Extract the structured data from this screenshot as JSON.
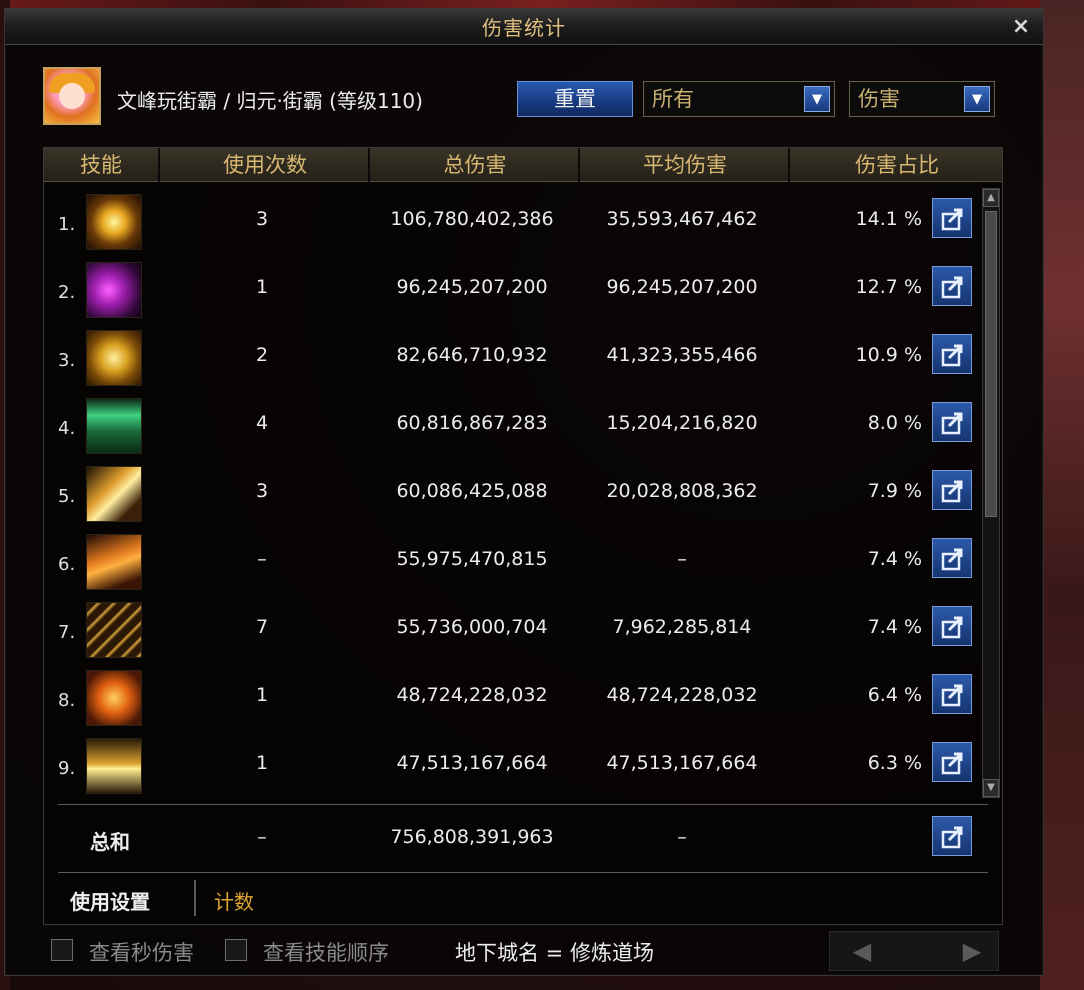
{
  "window": {
    "title": "伤害统计",
    "close_icon": "×"
  },
  "header": {
    "character": "文峰玩街霸 / 归元·街霸 (等级110)",
    "reset_label": "重置",
    "filter_selected": "所有",
    "metric_selected": "伤害",
    "dropdown_arrow": "▼"
  },
  "table": {
    "columns": [
      "技能",
      "使用次数",
      "总伤害",
      "平均伤害",
      "伤害占比"
    ],
    "rows": [
      {
        "num": "1.",
        "uses": "3",
        "total": "106,780,402,386",
        "avg": "35,593,467,462",
        "pct": "14.1 %"
      },
      {
        "num": "2.",
        "uses": "1",
        "total": "96,245,207,200",
        "avg": "96,245,207,200",
        "pct": "12.7 %"
      },
      {
        "num": "3.",
        "uses": "2",
        "total": "82,646,710,932",
        "avg": "41,323,355,466",
        "pct": "10.9 %"
      },
      {
        "num": "4.",
        "uses": "4",
        "total": "60,816,867,283",
        "avg": "15,204,216,820",
        "pct": "8.0 %"
      },
      {
        "num": "5.",
        "uses": "3",
        "total": "60,086,425,088",
        "avg": "20,028,808,362",
        "pct": "7.9 %"
      },
      {
        "num": "6.",
        "uses": "–",
        "total": "55,975,470,815",
        "avg": "–",
        "pct": "7.4 %"
      },
      {
        "num": "7.",
        "uses": "7",
        "total": "55,736,000,704",
        "avg": "7,962,285,814",
        "pct": "7.4 %"
      },
      {
        "num": "8.",
        "uses": "1",
        "total": "48,724,228,032",
        "avg": "48,724,228,032",
        "pct": "6.4 %"
      },
      {
        "num": "9.",
        "uses": "1",
        "total": "47,513,167,664",
        "avg": "47,513,167,664",
        "pct": "6.3 %"
      }
    ],
    "total": {
      "label": "总和",
      "uses": "–",
      "total": "756,808,391,963",
      "avg": "–"
    }
  },
  "tabs": {
    "settings": "使用设置",
    "count": "计数"
  },
  "footer": {
    "option1": "查看秒伤害",
    "option2": "查看技能顺序",
    "dungeon": "地下城名 = 修炼道场",
    "prev_icon": "◀",
    "next_icon": "▶"
  },
  "colors": {
    "accent_gold": "#d8b870",
    "button_blue": "#2a5ab0",
    "tab_active": "#e0a830"
  }
}
